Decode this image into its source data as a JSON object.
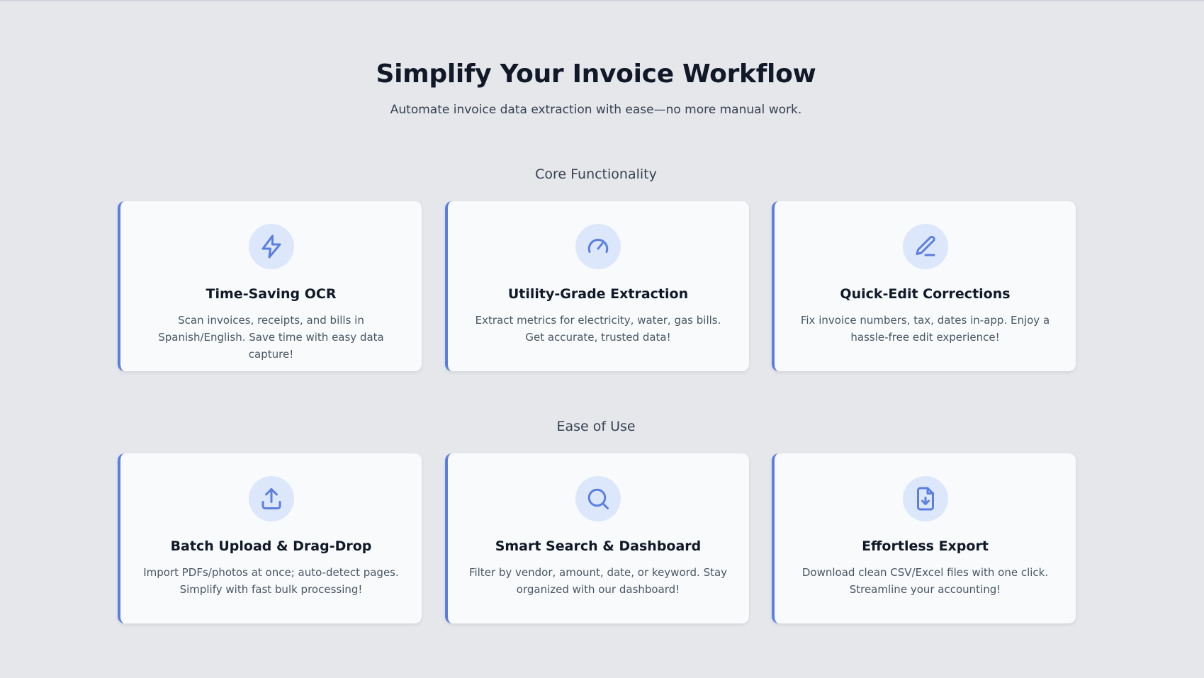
{
  "hero": {
    "title": "Simplify Your Invoice Workflow",
    "subtitle": "Automate invoice data extraction with ease—no more manual work."
  },
  "sections": [
    {
      "title": "Core Functionality",
      "cards": [
        {
          "icon": "lightning-icon",
          "title": "Time-Saving OCR",
          "description": "Scan invoices, receipts, and bills in Spanish/English. Save time with easy data capture!"
        },
        {
          "icon": "gauge-icon",
          "title": "Utility-Grade Extraction",
          "description": "Extract metrics for electricity, water, gas bills. Get accurate, trusted data!"
        },
        {
          "icon": "pencil-icon",
          "title": "Quick-Edit Corrections",
          "description": "Fix invoice numbers, tax, dates in-app. Enjoy a hassle-free edit experience!"
        }
      ]
    },
    {
      "title": "Ease of Use",
      "cards": [
        {
          "icon": "upload-icon",
          "title": "Batch Upload & Drag-Drop",
          "description": "Import PDFs/photos at once; auto-detect pages. Simplify with fast bulk processing!"
        },
        {
          "icon": "search-icon",
          "title": "Smart Search & Dashboard",
          "description": "Filter by vendor, amount, date, or keyword. Stay organized with our dashboard!"
        },
        {
          "icon": "file-download-icon",
          "title": "Effortless Export",
          "description": "Download clean CSV/Excel files with one click. Streamline your accounting!"
        }
      ]
    }
  ],
  "colors": {
    "accent": "#5b7fe0",
    "icon_bg": "#dde7fb",
    "page_bg": "#e6e7eb",
    "card_bg": "#f8fafc"
  }
}
